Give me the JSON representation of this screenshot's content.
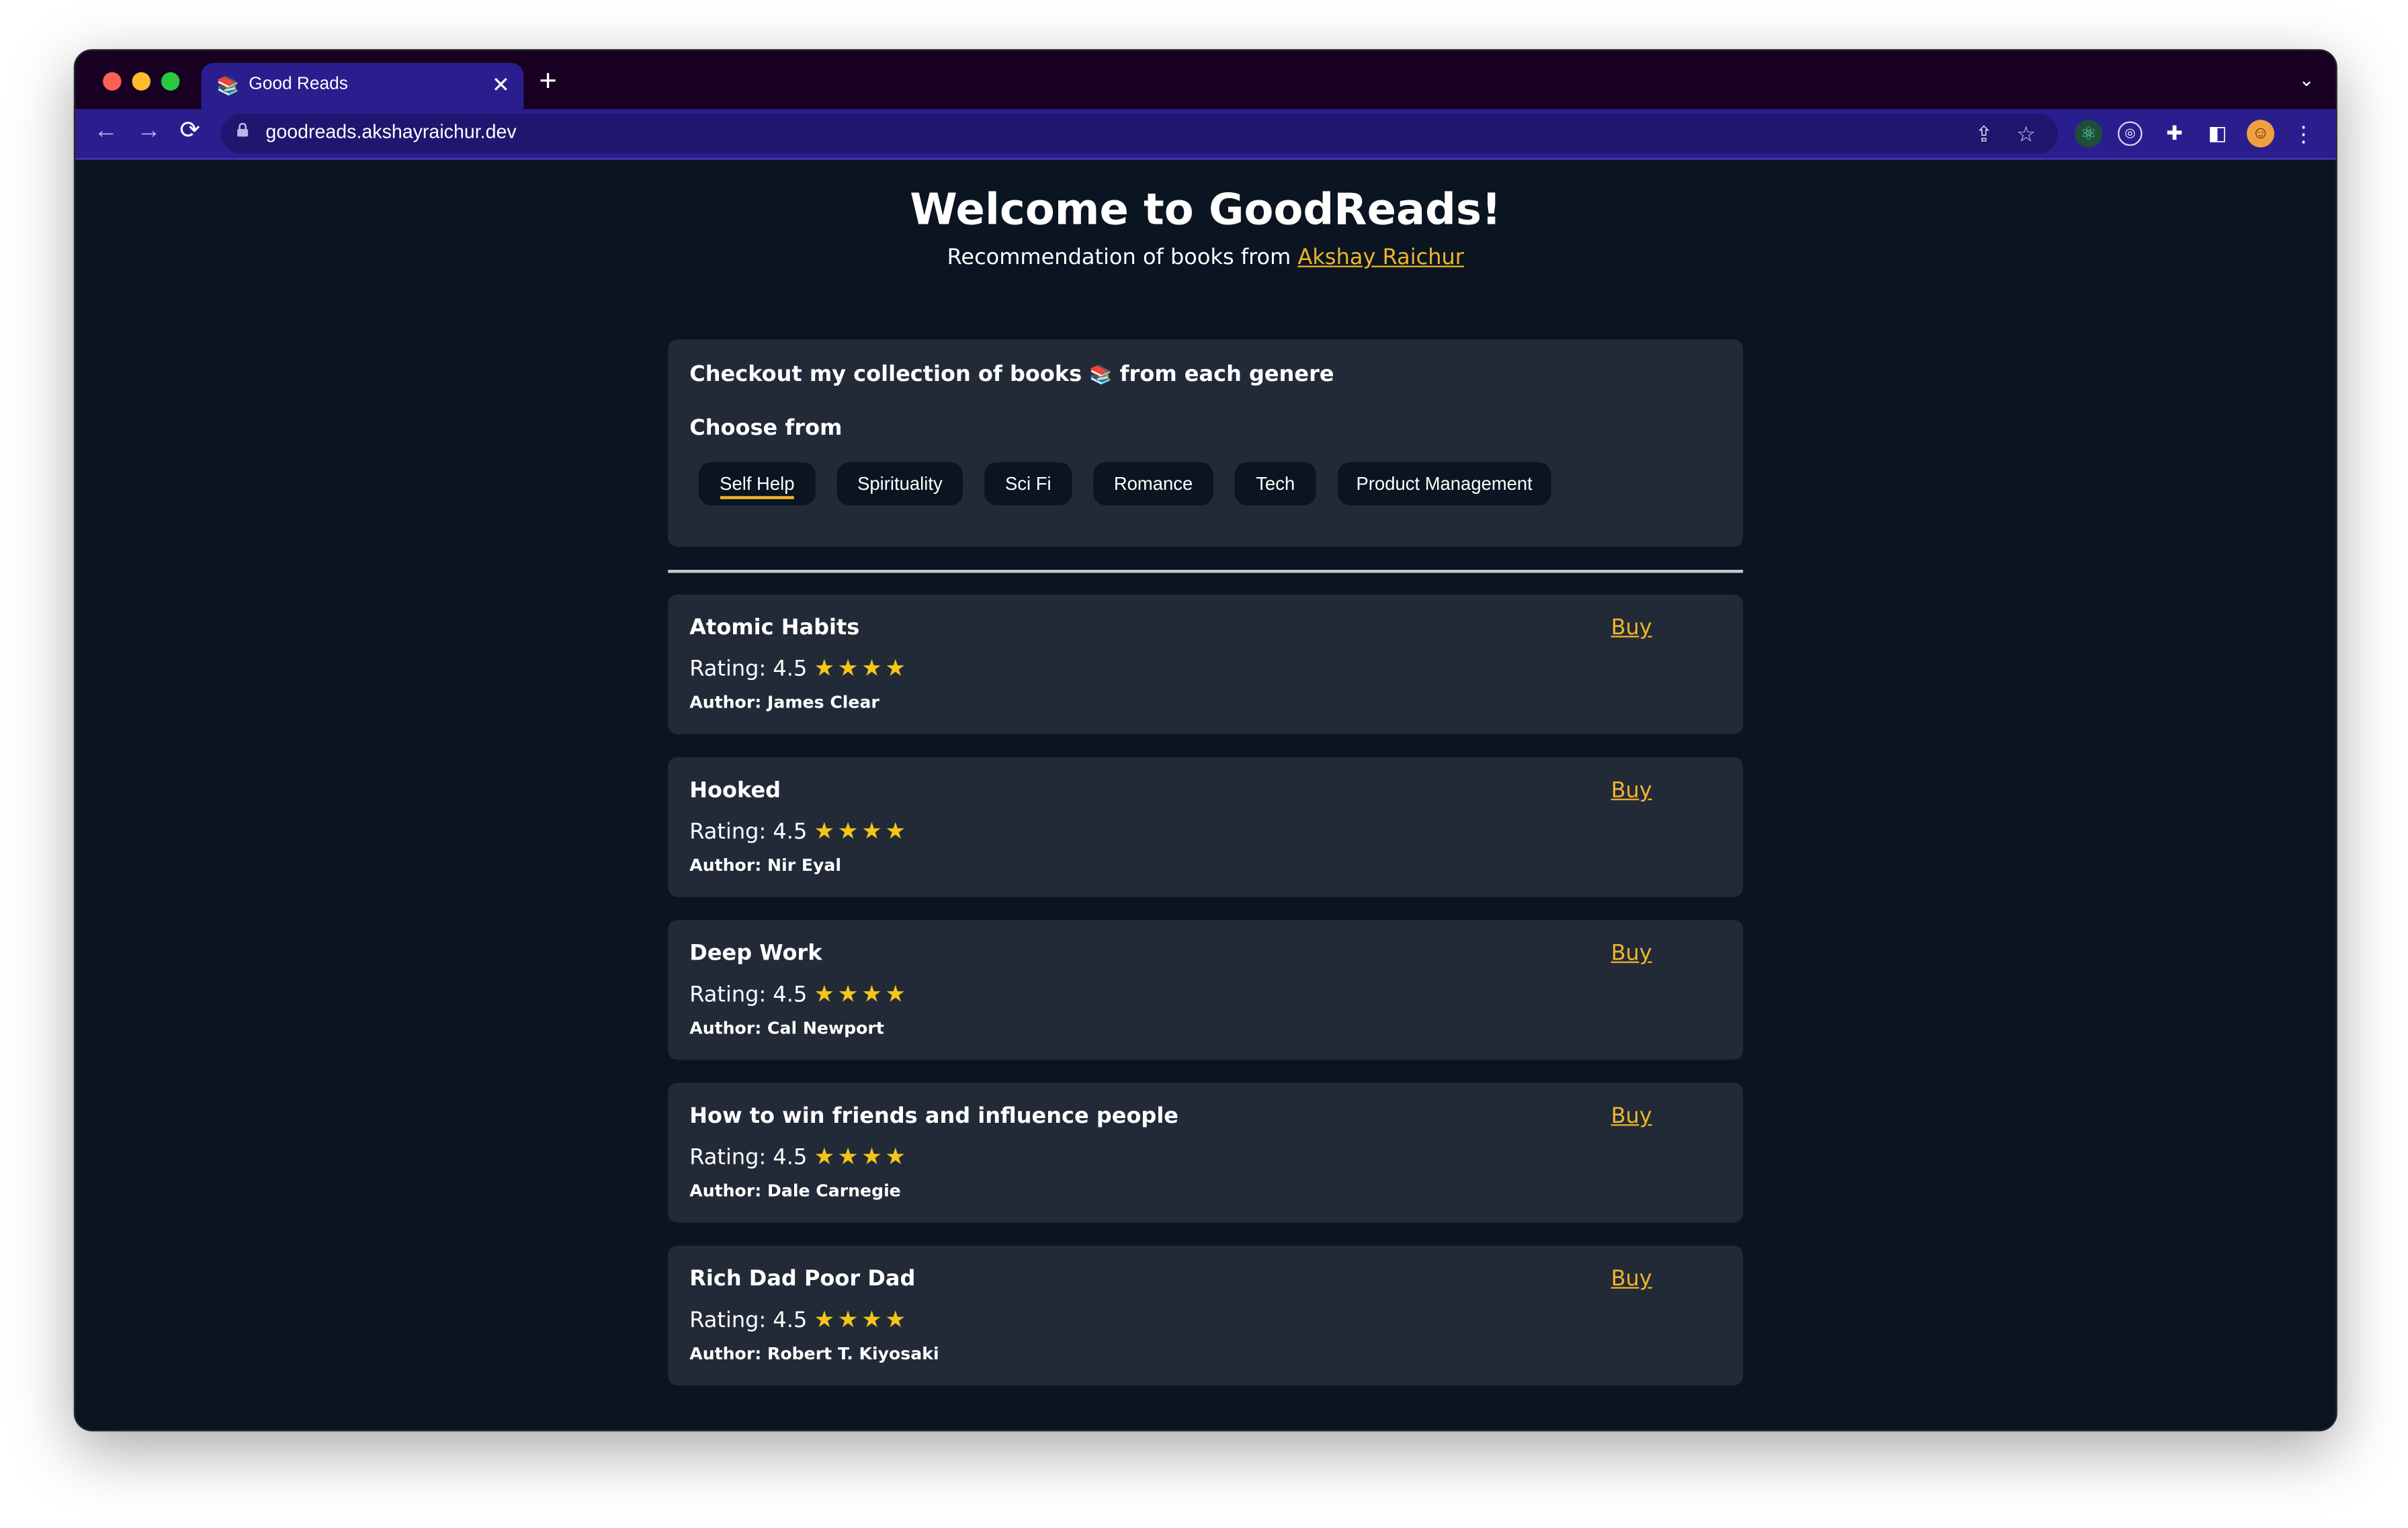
{
  "browser": {
    "tab_title": "Good Reads",
    "tab_favicon": "📚",
    "tab_close": "✕",
    "new_tab": "+",
    "tab_menu": "⌄",
    "url": "goodreads.akshayraichur.dev",
    "accent_color": "#2a1e8f"
  },
  "page": {
    "title": "Welcome to GoodReads!",
    "subtitle_prefix": "Recommendation of books from",
    "author_link": "Akshay Raichur"
  },
  "collection": {
    "heading_before": "Checkout my collection of books",
    "heading_emoji": "📚",
    "heading_after": "from each genere",
    "choose_label": "Choose from",
    "categories": [
      "Self Help",
      "Spirituality",
      "Sci Fi",
      "Romance",
      "Tech",
      "Product Management"
    ],
    "selected": "Self Help"
  },
  "books": [
    {
      "title": "Atomic Habits",
      "rating_label": "Rating:",
      "rating": "4.5",
      "stars": "★★★★",
      "author": "Author: James Clear",
      "buy": "Buy"
    },
    {
      "title": "Hooked",
      "rating_label": "Rating:",
      "rating": "4.5",
      "stars": "★★★★",
      "author": "Author: Nir Eyal",
      "buy": "Buy"
    },
    {
      "title": "Deep Work",
      "rating_label": "Rating:",
      "rating": "4.5",
      "stars": "★★★★",
      "author": "Author: Cal Newport",
      "buy": "Buy"
    },
    {
      "title": "How to win friends and influence people",
      "rating_label": "Rating:",
      "rating": "4.5",
      "stars": "★★★★",
      "author": "Author: Dale Carnegie",
      "buy": "Buy"
    },
    {
      "title": "Rich Dad Poor Dad",
      "rating_label": "Rating:",
      "rating": "4.5",
      "stars": "★★★★",
      "author": "Author: Robert T. Kiyosaki",
      "buy": "Buy"
    }
  ],
  "colors": {
    "background": "#0a1521",
    "card": "#222a38",
    "link": "#f0b429",
    "star": "#f5c518"
  }
}
